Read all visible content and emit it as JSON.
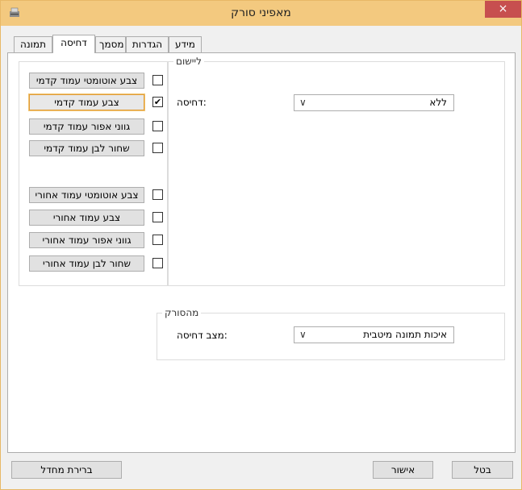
{
  "window": {
    "title": "מאפיני סורק",
    "close_glyph": "×"
  },
  "tabs": [
    {
      "label": "מידע"
    },
    {
      "label": "הגדרות"
    },
    {
      "label": "מסמך"
    },
    {
      "label": "דחיסה"
    },
    {
      "label": "תמונה"
    }
  ],
  "front": {
    "items": [
      {
        "label": "צבע אוטומטי עמוד קדמי",
        "checked": false
      },
      {
        "label": "צבע עמוד קדמי",
        "checked": true
      },
      {
        "label": "גווני אפור עמוד קדמי",
        "checked": false
      },
      {
        "label": "שחור לבן עמוד קדמי",
        "checked": false
      }
    ]
  },
  "rear": {
    "items": [
      {
        "label": "צבע אוטומטי עמוד אחורי",
        "checked": false
      },
      {
        "label": "צבע עמוד אחורי",
        "checked": false
      },
      {
        "label": "גווני אפור עמוד אחורי",
        "checked": false
      },
      {
        "label": "שחור לבן עמוד אחורי",
        "checked": false
      }
    ]
  },
  "checkmark": "✔",
  "registration": {
    "group_label": "ליישום",
    "compression_label": ":דחיסה",
    "compression_value": "ללא"
  },
  "scanner": {
    "group_label": "מהסורק",
    "mode_label": ":מצב דחיסה",
    "mode_value": "איכות תמונה מיטבית"
  },
  "dropdown_arrow": "∨",
  "footer": {
    "default_label": "ברירת מחדל",
    "ok_label": "אישור",
    "cancel_label": "בטל"
  },
  "colors": {
    "titlebar": "#f3c97f",
    "close_button": "#c74f4f",
    "focus_border": "#e09c3a"
  }
}
